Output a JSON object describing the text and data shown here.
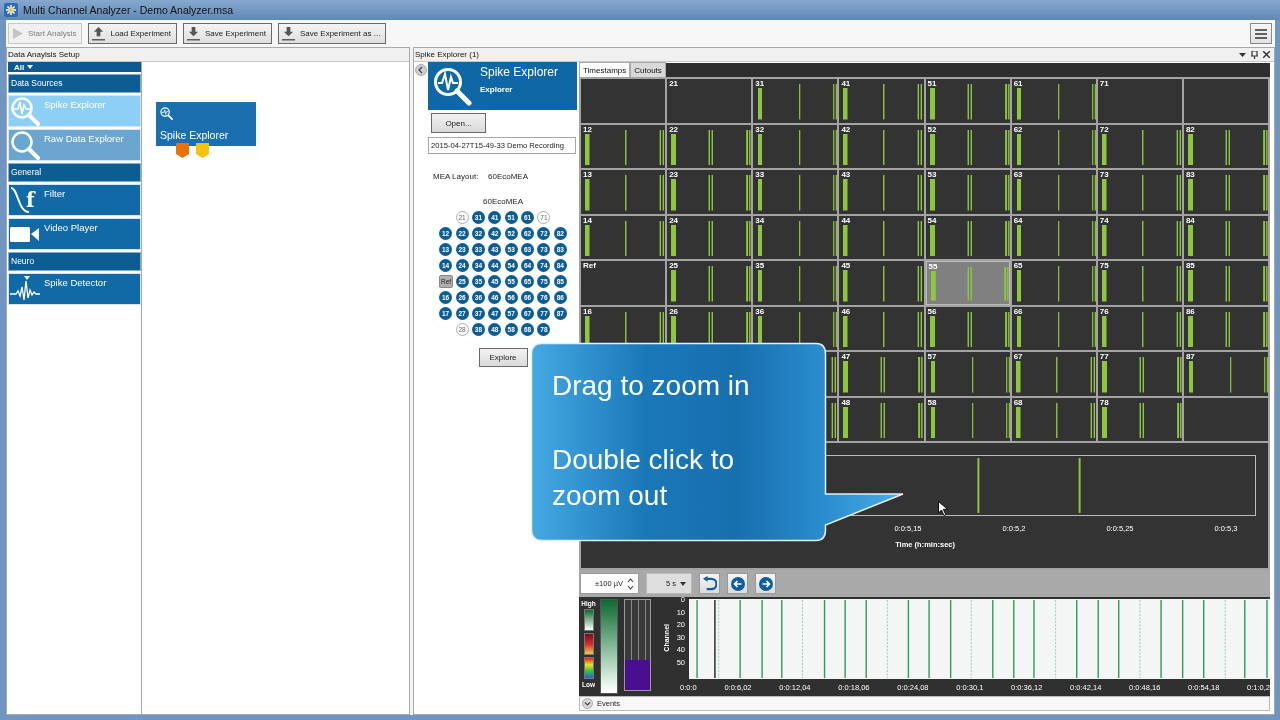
{
  "window": {
    "title": "Multi Channel Analyzer - Demo Analyzer.msa"
  },
  "toolbar": [
    {
      "label": "Start Analysis",
      "disabled": true
    },
    {
      "label": "Load Experiment",
      "disabled": false
    },
    {
      "label": "Save Experiment",
      "disabled": false
    },
    {
      "label": "Save Experiment as ...",
      "disabled": false
    }
  ],
  "setup_panel": {
    "title": "Data Anaylsis Setup",
    "filter": "All",
    "groups": [
      {
        "label": "Data Sources",
        "items": [
          {
            "label": "Spike Explorer",
            "selected": true,
            "hovered": false
          },
          {
            "label": "Raw Data Explorer",
            "selected": false,
            "hovered": true
          }
        ]
      },
      {
        "label": "General",
        "items": [
          {
            "label": "Filter",
            "icon_letter": "f",
            "selected": false,
            "hovered": false
          },
          {
            "label": "Video Player",
            "selected": false,
            "hovered": false
          }
        ]
      },
      {
        "label": "Neuro",
        "items": [
          {
            "label": "Spike Detector",
            "selected": false,
            "hovered": false
          }
        ]
      }
    ],
    "nodes": [
      {
        "label": "Spike Explorer",
        "ports": [
          {
            "color": "#e8720c"
          },
          {
            "color": "#f2c40f"
          }
        ]
      }
    ]
  },
  "explorer_panel": {
    "title": "Spike Explorer (1)",
    "plugin": {
      "title": "Spike Explorer",
      "subtitle": "Explorer"
    },
    "open_button": "Open...",
    "recording": "2015-04-27T15-49-33 Demo Recording",
    "layout_label": "MEA Layout:",
    "layout_value": "60EcoMEA",
    "mea_title": "60EcoMEA",
    "electrodes": [
      [
        {
          "label": "21",
          "kind": "inactive"
        },
        {
          "label": "31",
          "kind": "active"
        },
        {
          "label": "41",
          "kind": "active"
        },
        {
          "label": "51",
          "kind": "active"
        },
        {
          "label": "61",
          "kind": "active"
        },
        {
          "label": "71",
          "kind": "inactive"
        }
      ],
      [
        {
          "label": "12",
          "kind": "active"
        },
        {
          "label": "22",
          "kind": "active"
        },
        {
          "label": "32",
          "kind": "active"
        },
        {
          "label": "42",
          "kind": "active"
        },
        {
          "label": "52",
          "kind": "active"
        },
        {
          "label": "62",
          "kind": "active"
        },
        {
          "label": "72",
          "kind": "active"
        },
        {
          "label": "82",
          "kind": "active"
        }
      ],
      [
        {
          "label": "13",
          "kind": "active"
        },
        {
          "label": "23",
          "kind": "active"
        },
        {
          "label": "33",
          "kind": "active"
        },
        {
          "label": "43",
          "kind": "active"
        },
        {
          "label": "53",
          "kind": "active"
        },
        {
          "label": "63",
          "kind": "active"
        },
        {
          "label": "73",
          "kind": "active"
        },
        {
          "label": "83",
          "kind": "active"
        }
      ],
      [
        {
          "label": "14",
          "kind": "active"
        },
        {
          "label": "24",
          "kind": "active"
        },
        {
          "label": "34",
          "kind": "active"
        },
        {
          "label": "44",
          "kind": "active"
        },
        {
          "label": "54",
          "kind": "active"
        },
        {
          "label": "64",
          "kind": "active"
        },
        {
          "label": "74",
          "kind": "active"
        },
        {
          "label": "84",
          "kind": "active"
        }
      ],
      [
        {
          "label": "Ref",
          "kind": "ref"
        },
        {
          "label": "25",
          "kind": "active"
        },
        {
          "label": "35",
          "kind": "active"
        },
        {
          "label": "45",
          "kind": "active"
        },
        {
          "label": "55",
          "kind": "active"
        },
        {
          "label": "65",
          "kind": "active"
        },
        {
          "label": "75",
          "kind": "active"
        },
        {
          "label": "85",
          "kind": "active"
        }
      ],
      [
        {
          "label": "16",
          "kind": "active"
        },
        {
          "label": "26",
          "kind": "active"
        },
        {
          "label": "36",
          "kind": "active"
        },
        {
          "label": "46",
          "kind": "active"
        },
        {
          "label": "56",
          "kind": "active"
        },
        {
          "label": "66",
          "kind": "active"
        },
        {
          "label": "76",
          "kind": "active"
        },
        {
          "label": "86",
          "kind": "active"
        }
      ],
      [
        {
          "label": "17",
          "kind": "active"
        },
        {
          "label": "27",
          "kind": "active"
        },
        {
          "label": "37",
          "kind": "active"
        },
        {
          "label": "47",
          "kind": "active"
        },
        {
          "label": "57",
          "kind": "active"
        },
        {
          "label": "67",
          "kind": "active"
        },
        {
          "label": "77",
          "kind": "active"
        },
        {
          "label": "87",
          "kind": "active"
        }
      ],
      [
        {
          "label": "28",
          "kind": "inactive"
        },
        {
          "label": "38",
          "kind": "active"
        },
        {
          "label": "48",
          "kind": "active"
        },
        {
          "label": "58",
          "kind": "active"
        },
        {
          "label": "68",
          "kind": "active"
        },
        {
          "label": "78",
          "kind": "active"
        }
      ]
    ],
    "explore_button": "Explore",
    "tabs": [
      {
        "label": "Timestamps",
        "selected": true
      },
      {
        "label": "Cutouts",
        "selected": false
      }
    ],
    "channel_tiles": [
      [
        {
          "kind": "silent",
          "selected": false
        },
        {
          "kind": "silent",
          "label": "21",
          "selected": false
        },
        {
          "kind": "spikes",
          "label": "31",
          "selected": false
        },
        {
          "kind": "spikes",
          "label": "41",
          "selected": false
        },
        {
          "kind": "spikes",
          "label": "51",
          "selected": false
        },
        {
          "kind": "spikes",
          "label": "61",
          "selected": false
        },
        {
          "kind": "silent",
          "label": "71",
          "selected": false
        },
        {
          "kind": "silent",
          "selected": false
        }
      ],
      [
        {
          "kind": "spikes",
          "label": "12",
          "selected": false
        },
        {
          "kind": "spikes",
          "label": "22",
          "selected": false
        },
        {
          "kind": "spikes",
          "label": "32",
          "selected": false
        },
        {
          "kind": "spikes",
          "label": "42",
          "selected": false
        },
        {
          "kind": "spikes",
          "label": "52",
          "selected": false
        },
        {
          "kind": "spikes",
          "label": "62",
          "selected": false
        },
        {
          "kind": "spikes",
          "label": "72",
          "selected": false
        },
        {
          "kind": "spikes",
          "label": "82",
          "selected": false
        }
      ],
      [
        {
          "kind": "spikes",
          "label": "13",
          "selected": false
        },
        {
          "kind": "spikes",
          "label": "23",
          "selected": false
        },
        {
          "kind": "spikes",
          "label": "33",
          "selected": false
        },
        {
          "kind": "spikes",
          "label": "43",
          "selected": false
        },
        {
          "kind": "spikes",
          "label": "53",
          "selected": false
        },
        {
          "kind": "spikes",
          "label": "63",
          "selected": false
        },
        {
          "kind": "spikes",
          "label": "73",
          "selected": false
        },
        {
          "kind": "spikes",
          "label": "83",
          "selected": false
        }
      ],
      [
        {
          "kind": "spikes",
          "label": "14",
          "selected": false
        },
        {
          "kind": "spikes",
          "label": "24",
          "selected": false
        },
        {
          "kind": "spikes",
          "label": "34",
          "selected": false
        },
        {
          "kind": "spikes",
          "label": "44",
          "selected": false
        },
        {
          "kind": "spikes",
          "label": "54",
          "selected": false
        },
        {
          "kind": "spikes",
          "label": "64",
          "selected": false
        },
        {
          "kind": "spikes",
          "label": "74",
          "selected": false
        },
        {
          "kind": "spikes",
          "label": "84",
          "selected": false
        }
      ],
      [
        {
          "kind": "silent",
          "label": "Ref",
          "selected": false
        },
        {
          "kind": "spikes",
          "label": "25",
          "selected": false
        },
        {
          "kind": "spikes",
          "label": "35",
          "selected": false
        },
        {
          "kind": "spikes",
          "label": "45",
          "selected": false
        },
        {
          "kind": "spikes",
          "label": "55",
          "selected": true
        },
        {
          "kind": "spikes",
          "label": "65",
          "selected": false
        },
        {
          "kind": "spikes",
          "label": "75",
          "selected": false
        },
        {
          "kind": "spikes",
          "label": "85",
          "selected": false
        }
      ],
      [
        {
          "kind": "spikes",
          "label": "16",
          "selected": false
        },
        {
          "kind": "spikes",
          "label": "26",
          "selected": false
        },
        {
          "kind": "spikes",
          "label": "36",
          "selected": false
        },
        {
          "kind": "spikes",
          "label": "46",
          "selected": false
        },
        {
          "kind": "spikes",
          "label": "56",
          "selected": false
        },
        {
          "kind": "spikes",
          "label": "66",
          "selected": false
        },
        {
          "kind": "spikes",
          "label": "76",
          "selected": false
        },
        {
          "kind": "spikes",
          "label": "86",
          "selected": false
        }
      ],
      [
        {
          "kind": "spikes",
          "selected": false
        },
        {
          "kind": "spikes",
          "label": "47",
          "selected": false
        },
        {
          "kind": "spikes",
          "label": "57",
          "selected": false
        },
        {
          "kind": "spikes",
          "label": "67",
          "selected": false
        },
        {
          "kind": "spikes",
          "label": "77",
          "selected": false
        },
        {
          "kind": "spikes",
          "label": "87",
          "selected": false
        }
      ],
      [
        {
          "kind": "spikes",
          "selected": false
        },
        {
          "kind": "spikes",
          "label": "48",
          "selected": false
        },
        {
          "kind": "spikes",
          "label": "58",
          "selected": false
        },
        {
          "kind": "spikes",
          "label": "68",
          "selected": false
        },
        {
          "kind": "spikes",
          "label": "78",
          "selected": false
        },
        {
          "kind": "silent",
          "selected": false
        }
      ]
    ],
    "detail_plot": {
      "ticks": [
        "0:0:5,15",
        "0:0:5,2",
        "0:0:5,25",
        "0:0:5,3"
      ],
      "xlabel": "Time (h:min:sec)"
    },
    "controls": {
      "amplitude": "±100 µV",
      "timespan": "5 s"
    },
    "legend": {
      "high": "High",
      "low": "Low"
    },
    "meter": {
      "level": 0.33
    },
    "raster": {
      "ylabel": "Channel",
      "yticks": [
        "0",
        "10",
        "20",
        "30",
        "40",
        "50"
      ],
      "xticks": [
        "0:0:0",
        "0:0:6,02",
        "0:0:12,04",
        "0:0:18,06",
        "0:0:24,08",
        "0:0:30,1",
        "0:0:36,12",
        "0:0:42,14",
        "0:0:48,16",
        "0:0:54,18",
        "0:1:0,2"
      ]
    },
    "events": "Events"
  },
  "callout": {
    "lines": [
      "Drag to zoom in",
      "Double click to zoom out"
    ]
  }
}
